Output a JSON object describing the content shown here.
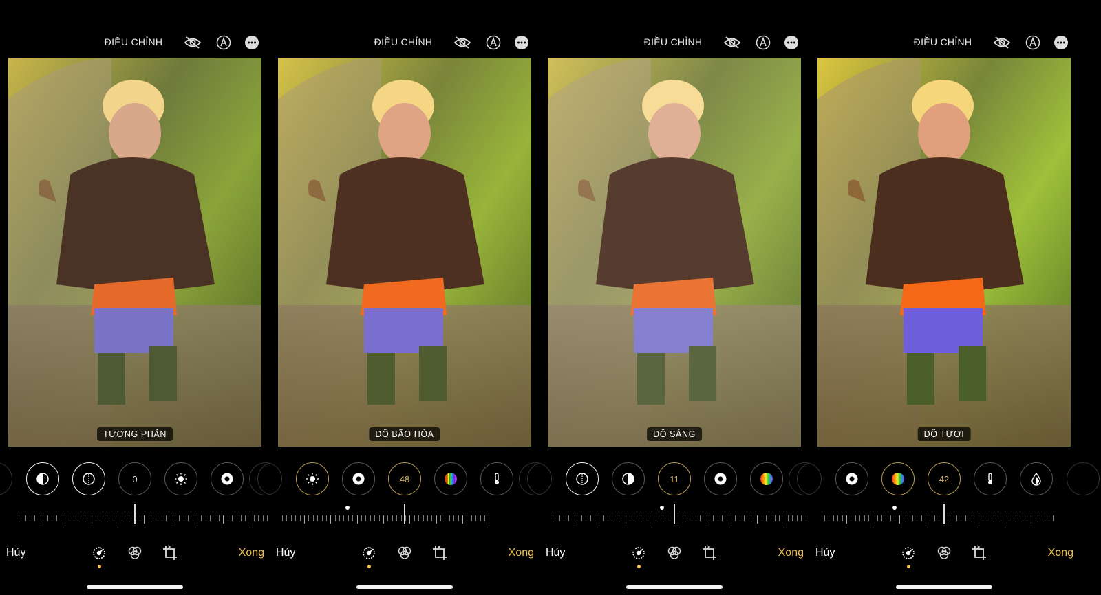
{
  "screens": [
    {
      "header": {
        "title": "ĐIỀU CHỈNH"
      },
      "adjustment_label": "TƯƠNG PHẢN",
      "current_value": "0",
      "buttons": {
        "cancel": "Hủy",
        "done": "Xong"
      }
    },
    {
      "header": {
        "title": "ĐIỀU CHỈNH"
      },
      "adjustment_label": "ĐỘ BÃO HÒA",
      "current_value": "48",
      "buttons": {
        "cancel": "Hủy",
        "done": "Xong"
      }
    },
    {
      "header": {
        "title": "ĐIỀU CHỈNH"
      },
      "adjustment_label": "ĐỘ SÁNG",
      "current_value": "11",
      "buttons": {
        "cancel": "Hủy",
        "done": "Xong"
      }
    },
    {
      "header": {
        "title": "ĐIỀU CHỈNH"
      },
      "adjustment_label": "ĐỘ TƯƠI",
      "current_value": "42",
      "buttons": {
        "cancel": "Hủy",
        "done": "Xong"
      }
    }
  ],
  "colors": {
    "accent": "#f5c24b",
    "gold_ring": "#b89a55",
    "background": "#000000"
  },
  "icons": [
    "eye-slash-icon",
    "markup-pen-icon",
    "more-icon",
    "adjust-dial-icon",
    "filters-icon",
    "crop-rotate-icon"
  ]
}
